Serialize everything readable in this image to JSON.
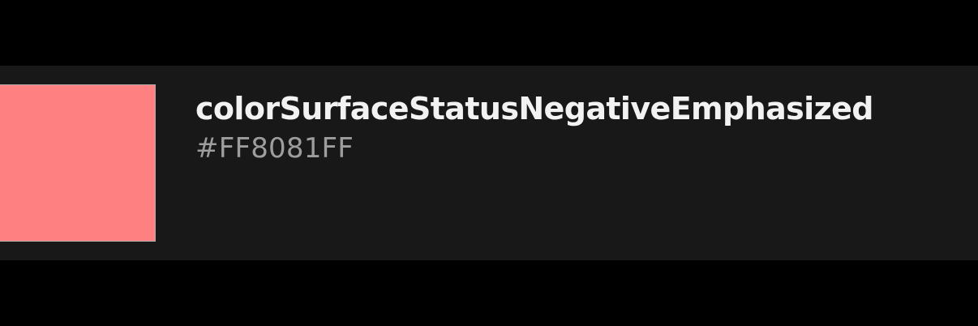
{
  "token": {
    "name": "colorSurfaceStatusNegativeEmphasized",
    "hex": "#FF8081FF",
    "swatch_color": "#FF8081"
  },
  "colors": {
    "page_background": "#000000",
    "card_background": "#181818",
    "name_text": "#F2F2F2",
    "hex_text": "#9D9D9D"
  }
}
